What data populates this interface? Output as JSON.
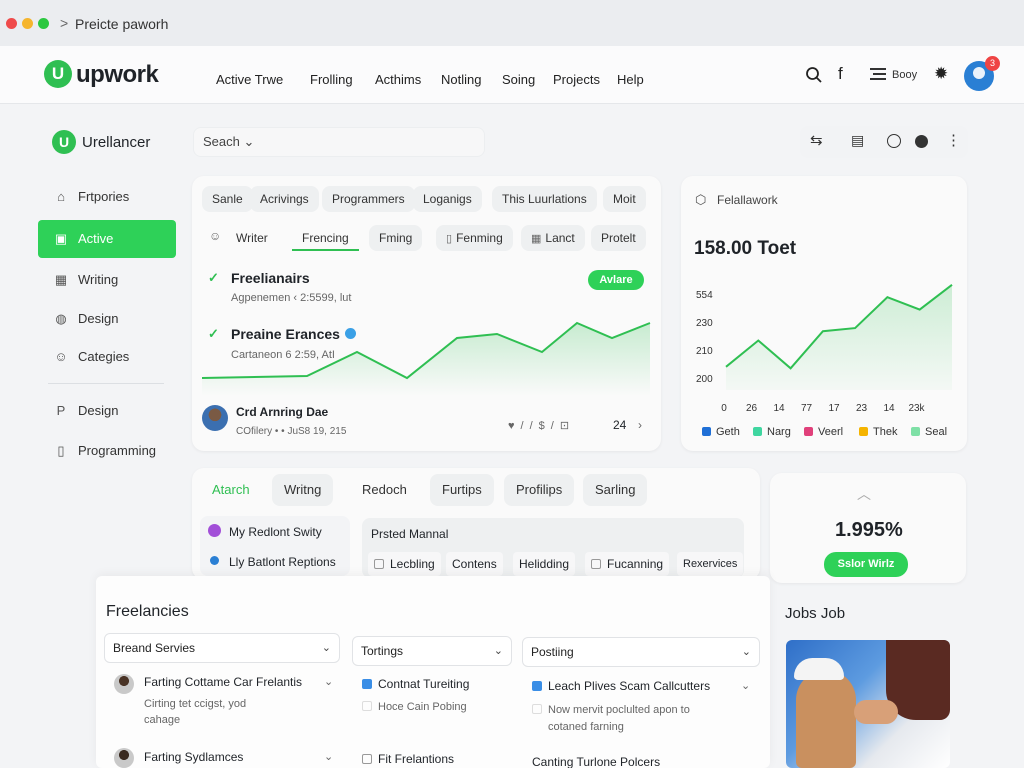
{
  "browser": {
    "tab_title": "Preicte paworh",
    "chevron": ">"
  },
  "header": {
    "logo_text": "upwork",
    "logo_mark": "U",
    "nav": [
      "Active Trwe",
      "Frolling",
      "Acthims",
      "Notling",
      "Soing",
      "Projects",
      "Help"
    ],
    "boy_label": "Boоy",
    "notification_count": "3"
  },
  "sidebar": {
    "brand": "Urellancer",
    "items": [
      {
        "label": "Frtpories",
        "icon": "tag-icon"
      },
      {
        "label": "Active",
        "icon": "briefcase-icon",
        "active": true
      },
      {
        "label": "Writing",
        "icon": "grid-icon"
      },
      {
        "label": "Design",
        "icon": "pen-icon"
      },
      {
        "label": "Categies",
        "icon": "people-icon"
      }
    ],
    "items2": [
      {
        "label": "Design",
        "icon": "p-icon"
      },
      {
        "label": "Programming",
        "icon": "doc-icon"
      }
    ]
  },
  "search": {
    "placeholder": "Seach ⌄"
  },
  "filters": {
    "row1": [
      "Sanle",
      "Acrivings",
      "Programmers",
      "Loganigs",
      "This Luurlations",
      "Moit"
    ],
    "row2": [
      "Writer",
      "Frencing",
      "Fming",
      "Fenming",
      "Lanct",
      "Protelt"
    ]
  },
  "jobs": [
    {
      "title": "Freelianairs",
      "sub": "Agpenemen ‹ 2:5599, lut",
      "badge": "Avlare"
    },
    {
      "title": "Preaine Erances",
      "sub": "Cartaneon 6 2:59, AtI"
    }
  ],
  "person": {
    "name": "Crd Arnring Dae",
    "meta": "COfilery  •  •  JuS8 19, 215",
    "count": "24"
  },
  "stats": {
    "title": "Felallawork",
    "value": "158.00 Toet",
    "chart_data": {
      "type": "area",
      "x": [
        "0",
        "26",
        "14",
        "77",
        "17",
        "23",
        "14",
        "23k"
      ],
      "values": [
        215,
        232,
        214,
        238,
        240,
        260,
        252,
        268
      ],
      "yticks": [
        "200",
        "210",
        "230",
        "554"
      ],
      "ylim": [
        200,
        275
      ],
      "legend": [
        {
          "name": "Geth",
          "color": "#1f6fd6"
        },
        {
          "name": "Narg",
          "color": "#3fd6a0"
        },
        {
          "name": "Veerl",
          "color": "#e0407a"
        },
        {
          "name": "Thek",
          "color": "#f5b400"
        },
        {
          "name": "Seal",
          "color": "#7ee0a6"
        }
      ]
    }
  },
  "tabs2": [
    "Atarch",
    "Writng",
    "Redoch",
    "Furtips",
    "Profilips",
    "Sarling"
  ],
  "mini_list": [
    {
      "label": "My Redlont Swity",
      "icon": "purple-dot-icon"
    },
    {
      "label": "Lly Batlont Reptions",
      "icon": "blue-dot-icon"
    }
  ],
  "posted": {
    "title": "Prsted Mannal",
    "chips": [
      "Lecbling",
      "Contens",
      "Helidding",
      "Fucanning",
      "Rexervices"
    ]
  },
  "stat2": {
    "value": "1.995%",
    "button": "Sslor Wirlz"
  },
  "freelancies": {
    "title": "Freelancies",
    "col1": {
      "select": "Breand Servies",
      "items": [
        {
          "title": "Farting Cottame Car Frelantis",
          "desc1": "Cirting tet ccigst, yod",
          "desc2": "cahage"
        },
        {
          "title": "Farting Sydlamces"
        }
      ]
    },
    "col2": {
      "select": "Tortings",
      "items": [
        "Contnat Tureiting",
        "Hoce Cain Pobing",
        "Fit Frelantions"
      ]
    },
    "col3": {
      "select": "Postiing",
      "items": [
        {
          "title": "Leach Plives Scam Callcutters",
          "desc1": "Now mervit poclulted apon to",
          "desc2": "cotaned farning"
        },
        {
          "title": "Canting Turlone Polcers"
        }
      ]
    }
  },
  "jobs_job": {
    "title": "Jobs Job"
  }
}
